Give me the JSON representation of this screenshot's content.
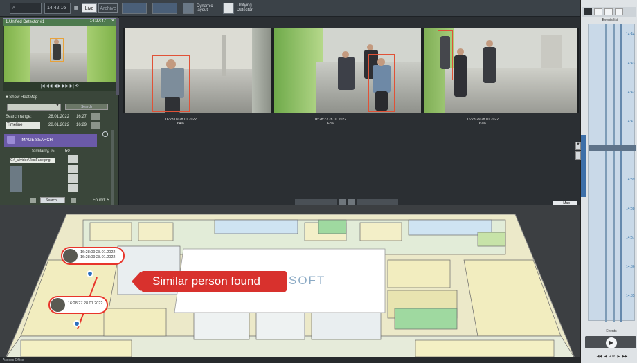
{
  "toolbar": {
    "time": "14:42:16",
    "live_label": "Live",
    "archive_label": "Archive",
    "dynamic_layout_label": "Dynamic layout",
    "layout_label": "Unifying Detector"
  },
  "camera": {
    "title": "1.Unified Detector #1",
    "timestamp": "14:27:47"
  },
  "left": {
    "show_heatmap": "Show HeatMap",
    "search_button": "Search",
    "search_range_label": "Search range:",
    "timeline_option": "Timeline",
    "date_from": "28.01.2022",
    "time_from": "16:27",
    "date_to": "28.01.2022",
    "time_to": "16:29",
    "image_search_label": "IMAGE SEARCH",
    "similarity_label": "Similarity, %",
    "similarity_value": "50",
    "file_path": "C:\\_w\\video\\TestFace.png",
    "search_button2": "Search...",
    "found": "Found: 5"
  },
  "results": [
    {
      "time": "16:28:09 28.01.2022",
      "score": "64%"
    },
    {
      "time": "16:28:27 28.01.2022",
      "score": "62%"
    },
    {
      "time": "16:28:29 28.01.2022",
      "score": "62%"
    }
  ],
  "map": {
    "callout": "Similar person found",
    "logo_text": "SOFT",
    "bubble1_line1": "16:28:09 28.01.2022",
    "bubble1_line2": "16:28:09 28.01.2022",
    "bubble2_line1": "16:28:27 28.01.2022"
  },
  "right": {
    "title": "Events list",
    "events_label": "Events",
    "tab_label": "Events"
  },
  "status": {
    "left_text": "Access Office"
  },
  "colors": {
    "accent": "#d8312d",
    "frame": "#e05237",
    "map_green": "#9fd9a0",
    "map_yellow": "#f1ecb5"
  }
}
